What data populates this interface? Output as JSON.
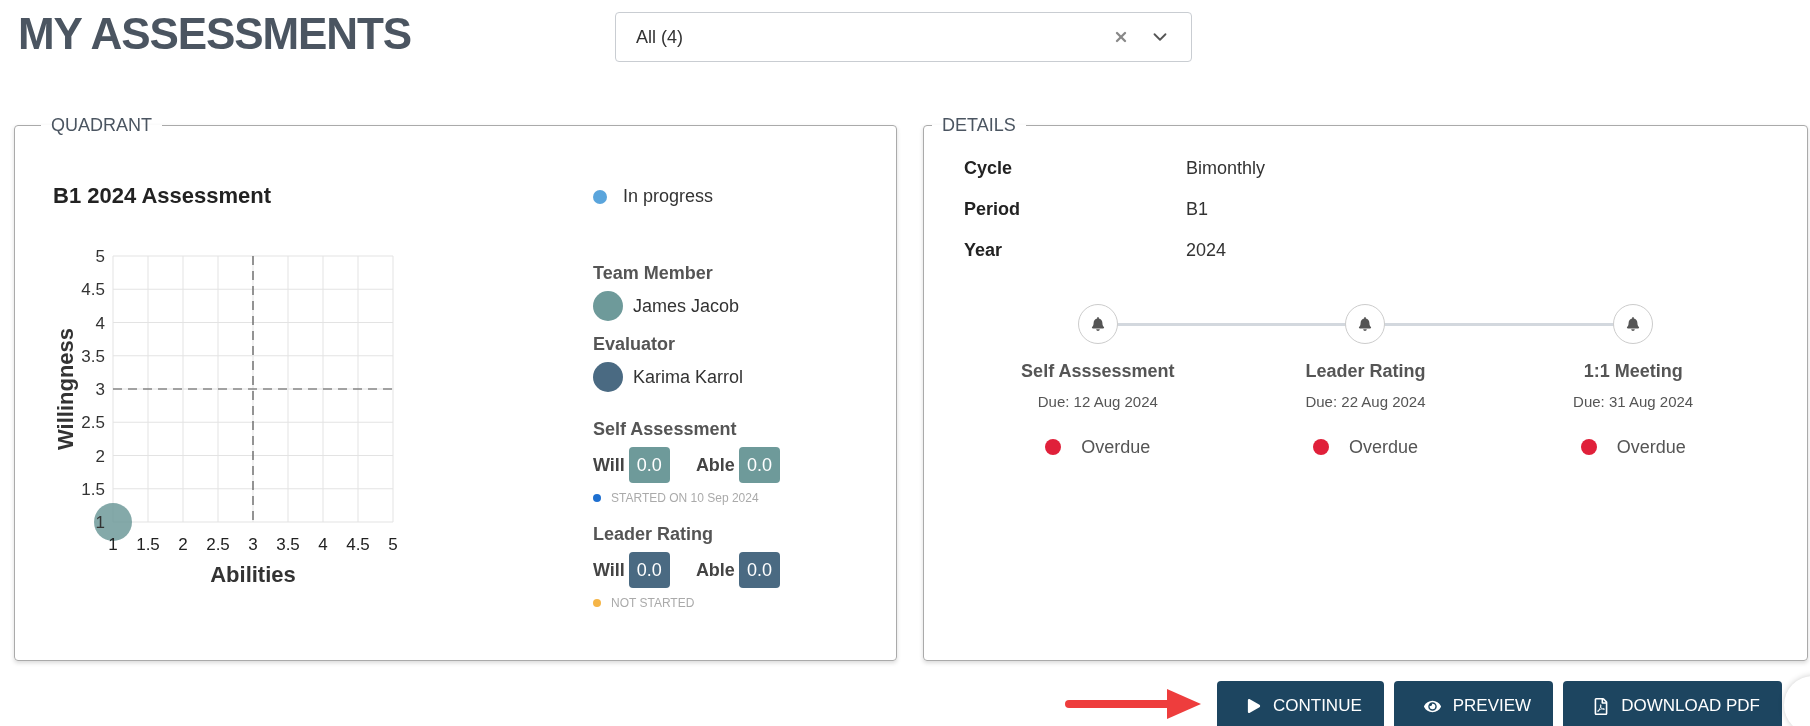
{
  "page": {
    "title": "MY ASSESSMENTS"
  },
  "filter": {
    "value": "All (4)"
  },
  "quadrant": {
    "legend": "QUADRANT",
    "title": "B1 2024 Assessment",
    "status": {
      "label": "In progress",
      "color": "#5aa5dc"
    },
    "chart_data": {
      "type": "scatter",
      "grid": true,
      "xlabel": "Abilities",
      "ylabel": "Willingness",
      "xlim": [
        1,
        5
      ],
      "ylim": [
        1,
        5
      ],
      "xticks": [
        1,
        1.5,
        2,
        2.5,
        3,
        3.5,
        4,
        4.5,
        5
      ],
      "yticks": [
        1,
        1.5,
        2,
        2.5,
        3,
        3.5,
        4,
        4.5,
        5
      ],
      "x": [
        1
      ],
      "series": [
        {
          "color": "#6e9a9a",
          "values": [
            1
          ]
        }
      ]
    },
    "people": [
      {
        "role": "Team Member",
        "name": "James Jacob",
        "color": "#6e9a9a"
      },
      {
        "role": "Evaluator",
        "name": "Karima Karrol",
        "color": "#4a6a82"
      }
    ],
    "ratings": [
      {
        "title": "Self Assessment",
        "will_label": "Will",
        "will": "0.0",
        "able_label": "Able",
        "able": "0.0",
        "status": "STARTED ON 10 Sep 2024",
        "color": "#1e6fd0"
      },
      {
        "title": "Leader Rating",
        "will_label": "Will",
        "will": "0.0",
        "able_label": "Able",
        "able": "0.0",
        "status": "NOT STARTED",
        "color": "#f5b548"
      }
    ]
  },
  "details": {
    "legend": "DETAILS",
    "rows": [
      {
        "label": "Cycle",
        "value": "Bimonthly"
      },
      {
        "label": "Period",
        "value": "B1"
      },
      {
        "label": "Year",
        "value": "2024"
      }
    ],
    "steps": [
      {
        "title": "Self Asssessment",
        "due": "Due: 12 Aug 2024",
        "status": "Overdue",
        "color": "#e0203a"
      },
      {
        "title": "Leader Rating",
        "due": "Due: 22 Aug 2024",
        "status": "Overdue",
        "color": "#e0203a"
      },
      {
        "title": "1:1 Meeting",
        "due": "Due: 31 Aug 2024",
        "status": "Overdue",
        "color": "#e0203a"
      }
    ]
  },
  "actions": [
    {
      "label": "CONTINUE",
      "kind": "play"
    },
    {
      "label": "PREVIEW",
      "kind": "view"
    },
    {
      "label": "DOWNLOAD PDF",
      "kind": "pdf"
    }
  ]
}
